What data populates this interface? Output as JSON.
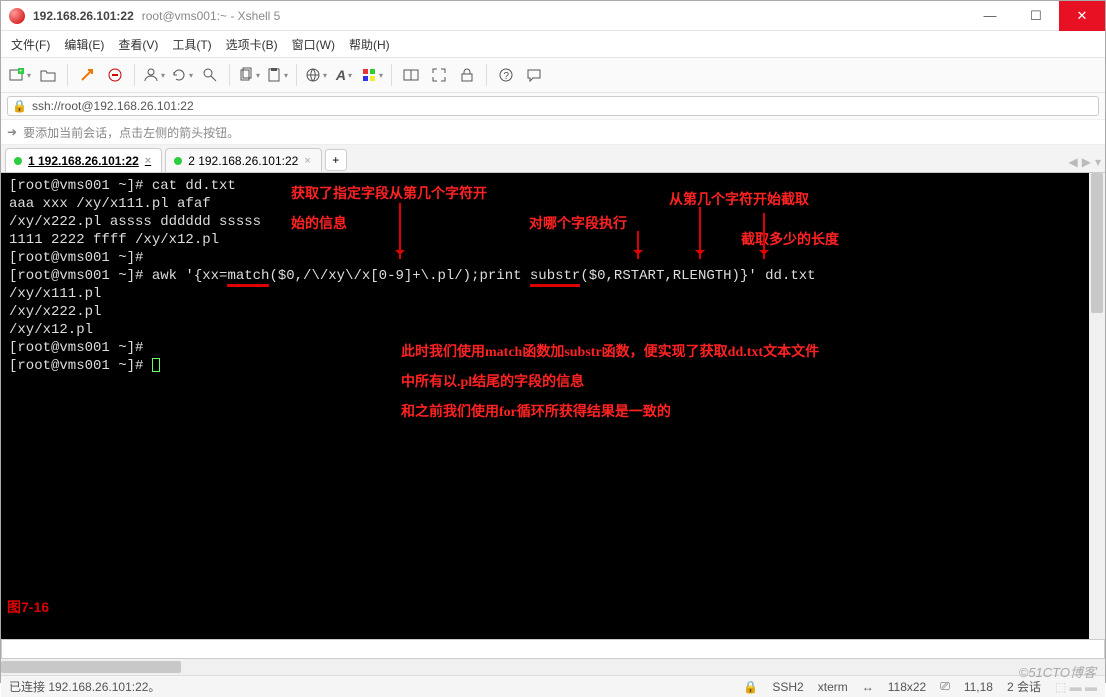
{
  "window": {
    "title_main": "192.168.26.101:22",
    "title_sub": "root@vms001:~ - Xshell 5"
  },
  "menu": {
    "file": "文件(F)",
    "edit": "编辑(E)",
    "view": "查看(V)",
    "tools": "工具(T)",
    "tab": "选项卡(B)",
    "window": "窗口(W)",
    "help": "帮助(H)"
  },
  "address": {
    "value": "ssh://root@192.168.26.101:22"
  },
  "hint": {
    "text": "要添加当前会话，点击左侧的箭头按钮。"
  },
  "tabs": [
    {
      "label": "1 192.168.26.101:22",
      "active": true
    },
    {
      "label": "2 192.168.26.101:22",
      "active": false
    }
  ],
  "terminal": {
    "lines": [
      "[root@vms001 ~]# cat dd.txt",
      "aaa xxx /xy/x111.pl afaf",
      "/xy/x222.pl assss dddddd sssss",
      "1111 2222 ffff /xy/x12.pl",
      "[root@vms001 ~]#",
      "[root@vms001 ~]# awk '{xx=match($0,/\\/xy\\/x[0-9]+\\.pl/);print substr($0,RSTART,RLENGTH)}' dd.txt",
      "/xy/x111.pl",
      "/xy/x222.pl",
      "/xy/x12.pl",
      "[root@vms001 ~]#",
      "[root@vms001 ~]# "
    ],
    "awk_prefix": "[root@vms001 ~]# awk '{xx=",
    "awk_match": "match",
    "awk_mid1": "($0,/\\/xy\\/x[0-9]+\\.pl/);print ",
    "awk_substr": "substr",
    "awk_mid2": "($0,RSTART,RLENGTH)}' dd.txt"
  },
  "annotations": {
    "a1_line1": "获取了指定字段从第几个字符开",
    "a1_line2": "始的信息",
    "a2": "对哪个字段执行",
    "a3": "从第几个字符开始截取",
    "a4": "截取多少的长度",
    "b1": "此时我们使用match函数加substr函数，便实现了获取dd.txt文本文件",
    "b2": "中所有以.pl结尾的字段的信息",
    "b3": "和之前我们使用for循环所获得结果是一致的",
    "fig": "图7-16"
  },
  "status": {
    "left": "已连接 192.168.26.101:22。",
    "proto": "SSH2",
    "term": "xterm",
    "size": "118x22",
    "cursor": "11,18",
    "sessions": "2 会话"
  },
  "watermark": "©51CTO博客"
}
